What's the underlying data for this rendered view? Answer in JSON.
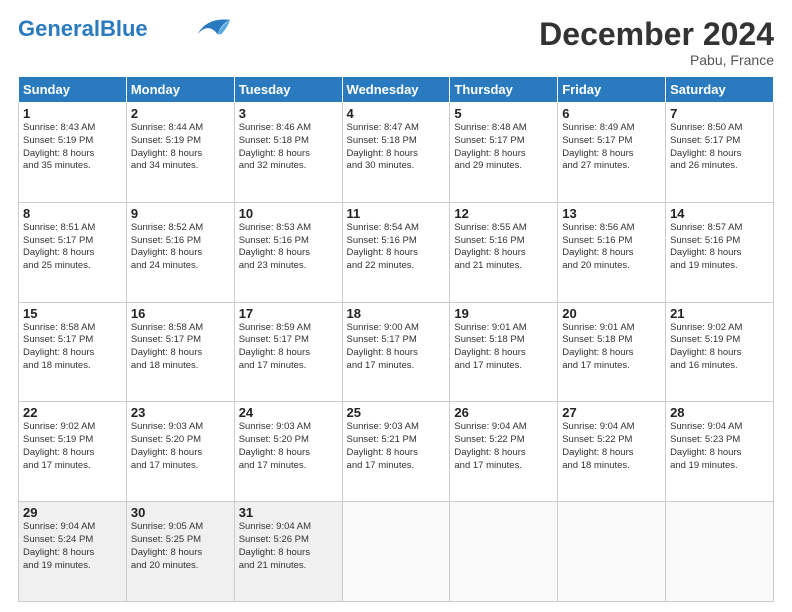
{
  "header": {
    "logo_text_general": "General",
    "logo_text_blue": "Blue",
    "month_title": "December 2024",
    "location": "Pabu, France"
  },
  "days_of_week": [
    "Sunday",
    "Monday",
    "Tuesday",
    "Wednesday",
    "Thursday",
    "Friday",
    "Saturday"
  ],
  "weeks": [
    [
      {
        "day": "1",
        "lines": [
          "Sunrise: 8:43 AM",
          "Sunset: 5:19 PM",
          "Daylight: 8 hours",
          "and 35 minutes."
        ]
      },
      {
        "day": "2",
        "lines": [
          "Sunrise: 8:44 AM",
          "Sunset: 5:19 PM",
          "Daylight: 8 hours",
          "and 34 minutes."
        ]
      },
      {
        "day": "3",
        "lines": [
          "Sunrise: 8:46 AM",
          "Sunset: 5:18 PM",
          "Daylight: 8 hours",
          "and 32 minutes."
        ]
      },
      {
        "day": "4",
        "lines": [
          "Sunrise: 8:47 AM",
          "Sunset: 5:18 PM",
          "Daylight: 8 hours",
          "and 30 minutes."
        ]
      },
      {
        "day": "5",
        "lines": [
          "Sunrise: 8:48 AM",
          "Sunset: 5:17 PM",
          "Daylight: 8 hours",
          "and 29 minutes."
        ]
      },
      {
        "day": "6",
        "lines": [
          "Sunrise: 8:49 AM",
          "Sunset: 5:17 PM",
          "Daylight: 8 hours",
          "and 27 minutes."
        ]
      },
      {
        "day": "7",
        "lines": [
          "Sunrise: 8:50 AM",
          "Sunset: 5:17 PM",
          "Daylight: 8 hours",
          "and 26 minutes."
        ]
      }
    ],
    [
      {
        "day": "8",
        "lines": [
          "Sunrise: 8:51 AM",
          "Sunset: 5:17 PM",
          "Daylight: 8 hours",
          "and 25 minutes."
        ]
      },
      {
        "day": "9",
        "lines": [
          "Sunrise: 8:52 AM",
          "Sunset: 5:16 PM",
          "Daylight: 8 hours",
          "and 24 minutes."
        ]
      },
      {
        "day": "10",
        "lines": [
          "Sunrise: 8:53 AM",
          "Sunset: 5:16 PM",
          "Daylight: 8 hours",
          "and 23 minutes."
        ]
      },
      {
        "day": "11",
        "lines": [
          "Sunrise: 8:54 AM",
          "Sunset: 5:16 PM",
          "Daylight: 8 hours",
          "and 22 minutes."
        ]
      },
      {
        "day": "12",
        "lines": [
          "Sunrise: 8:55 AM",
          "Sunset: 5:16 PM",
          "Daylight: 8 hours",
          "and 21 minutes."
        ]
      },
      {
        "day": "13",
        "lines": [
          "Sunrise: 8:56 AM",
          "Sunset: 5:16 PM",
          "Daylight: 8 hours",
          "and 20 minutes."
        ]
      },
      {
        "day": "14",
        "lines": [
          "Sunrise: 8:57 AM",
          "Sunset: 5:16 PM",
          "Daylight: 8 hours",
          "and 19 minutes."
        ]
      }
    ],
    [
      {
        "day": "15",
        "lines": [
          "Sunrise: 8:58 AM",
          "Sunset: 5:17 PM",
          "Daylight: 8 hours",
          "and 18 minutes."
        ]
      },
      {
        "day": "16",
        "lines": [
          "Sunrise: 8:58 AM",
          "Sunset: 5:17 PM",
          "Daylight: 8 hours",
          "and 18 minutes."
        ]
      },
      {
        "day": "17",
        "lines": [
          "Sunrise: 8:59 AM",
          "Sunset: 5:17 PM",
          "Daylight: 8 hours",
          "and 17 minutes."
        ]
      },
      {
        "day": "18",
        "lines": [
          "Sunrise: 9:00 AM",
          "Sunset: 5:17 PM",
          "Daylight: 8 hours",
          "and 17 minutes."
        ]
      },
      {
        "day": "19",
        "lines": [
          "Sunrise: 9:01 AM",
          "Sunset: 5:18 PM",
          "Daylight: 8 hours",
          "and 17 minutes."
        ]
      },
      {
        "day": "20",
        "lines": [
          "Sunrise: 9:01 AM",
          "Sunset: 5:18 PM",
          "Daylight: 8 hours",
          "and 17 minutes."
        ]
      },
      {
        "day": "21",
        "lines": [
          "Sunrise: 9:02 AM",
          "Sunset: 5:19 PM",
          "Daylight: 8 hours",
          "and 16 minutes."
        ]
      }
    ],
    [
      {
        "day": "22",
        "lines": [
          "Sunrise: 9:02 AM",
          "Sunset: 5:19 PM",
          "Daylight: 8 hours",
          "and 17 minutes."
        ]
      },
      {
        "day": "23",
        "lines": [
          "Sunrise: 9:03 AM",
          "Sunset: 5:20 PM",
          "Daylight: 8 hours",
          "and 17 minutes."
        ]
      },
      {
        "day": "24",
        "lines": [
          "Sunrise: 9:03 AM",
          "Sunset: 5:20 PM",
          "Daylight: 8 hours",
          "and 17 minutes."
        ]
      },
      {
        "day": "25",
        "lines": [
          "Sunrise: 9:03 AM",
          "Sunset: 5:21 PM",
          "Daylight: 8 hours",
          "and 17 minutes."
        ]
      },
      {
        "day": "26",
        "lines": [
          "Sunrise: 9:04 AM",
          "Sunset: 5:22 PM",
          "Daylight: 8 hours",
          "and 17 minutes."
        ]
      },
      {
        "day": "27",
        "lines": [
          "Sunrise: 9:04 AM",
          "Sunset: 5:22 PM",
          "Daylight: 8 hours",
          "and 18 minutes."
        ]
      },
      {
        "day": "28",
        "lines": [
          "Sunrise: 9:04 AM",
          "Sunset: 5:23 PM",
          "Daylight: 8 hours",
          "and 19 minutes."
        ]
      }
    ],
    [
      {
        "day": "29",
        "lines": [
          "Sunrise: 9:04 AM",
          "Sunset: 5:24 PM",
          "Daylight: 8 hours",
          "and 19 minutes."
        ]
      },
      {
        "day": "30",
        "lines": [
          "Sunrise: 9:05 AM",
          "Sunset: 5:25 PM",
          "Daylight: 8 hours",
          "and 20 minutes."
        ]
      },
      {
        "day": "31",
        "lines": [
          "Sunrise: 9:04 AM",
          "Sunset: 5:26 PM",
          "Daylight: 8 hours",
          "and 21 minutes."
        ]
      },
      null,
      null,
      null,
      null
    ]
  ]
}
